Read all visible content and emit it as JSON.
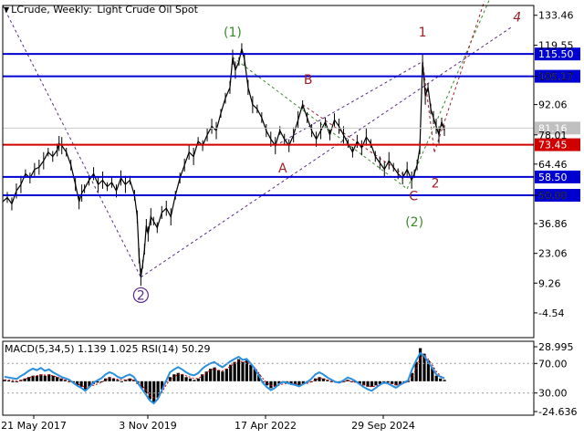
{
  "header": {
    "symbol": "LCrude, Weekly:",
    "description": "Light Crude Oil Spot",
    "icon": "down-triangle-icon"
  },
  "indicator_header": "MACD(5,34,5) 1.139 1.025 RSI(14) 50.29",
  "colors": {
    "price": "#000000",
    "level_blue": "#0000d0",
    "level_red": "#d00000",
    "current_price_tag": "#c0c0c0",
    "wave_green": "#3a8a2a",
    "wave_red": "#a0202a",
    "wave_purple": "#5a2a8a",
    "rsi": "#2b8fe0",
    "macd_signal": "#d00000"
  },
  "chart_data": [
    {
      "type": "line",
      "title": "LCrude, Weekly: Light Crude Oil Spot",
      "ylim": [
        -16,
        138
      ],
      "price_axis_ticks": [
        133.46,
        119.55,
        105.17,
        92.06,
        78.01,
        64.46,
        50.0,
        36.86,
        23.06,
        9.26,
        -4.54
      ],
      "x_tick_labels": [
        "21 May 2017",
        "3 Nov 2019",
        "17 Apr 2022",
        "29 Sep 2024"
      ],
      "current_price": 81.16,
      "levels": [
        {
          "value": 115.5,
          "label": "115.50",
          "color": "blue"
        },
        {
          "value": 105.17,
          "label": "105.17",
          "color": "blue"
        },
        {
          "value": 73.45,
          "label": "73.45",
          "color": "red"
        },
        {
          "value": 58.5,
          "label": "58.50",
          "color": "blue"
        },
        {
          "value": 50.0,
          "label": "50.00",
          "color": "blue"
        }
      ],
      "series": [
        {
          "values": [
            [
              0,
              47
            ],
            [
              5,
              49
            ],
            [
              10,
              46
            ],
            [
              15,
              52
            ],
            [
              20,
              55
            ],
            [
              25,
              60
            ],
            [
              30,
              58
            ],
            [
              35,
              62
            ],
            [
              40,
              63
            ],
            [
              45,
              66
            ],
            [
              50,
              70
            ],
            [
              55,
              68
            ],
            [
              60,
              71
            ],
            [
              62,
              74
            ],
            [
              65,
              73
            ],
            [
              70,
              70
            ],
            [
              75,
              64
            ],
            [
              80,
              55
            ],
            [
              84,
              47
            ],
            [
              87,
              51
            ],
            [
              90,
              53
            ],
            [
              95,
              57
            ],
            [
              100,
              60
            ],
            [
              105,
              55
            ],
            [
              110,
              57
            ],
            [
              115,
              54
            ],
            [
              120,
              56
            ],
            [
              125,
              52
            ],
            [
              130,
              58
            ],
            [
              135,
              55
            ],
            [
              140,
              57
            ],
            [
              145,
              50
            ],
            [
              148,
              40
            ],
            [
              150,
              22
            ],
            [
              152,
              12
            ],
            [
              154,
              18
            ],
            [
              156,
              25
            ],
            [
              158,
              36
            ],
            [
              160,
              32
            ],
            [
              163,
              40
            ],
            [
              166,
              38
            ],
            [
              170,
              35
            ],
            [
              175,
              42
            ],
            [
              180,
              44
            ],
            [
              185,
              40
            ],
            [
              190,
              50
            ],
            [
              195,
              58
            ],
            [
              200,
              64
            ],
            [
              205,
              70
            ],
            [
              210,
              68
            ],
            [
              215,
              75
            ],
            [
              220,
              73
            ],
            [
              225,
              78
            ],
            [
              230,
              82
            ],
            [
              235,
              80
            ],
            [
              240,
              88
            ],
            [
              245,
              95
            ],
            [
              250,
              100
            ],
            [
              253,
              114
            ],
            [
              256,
              108
            ],
            [
              260,
              112
            ],
            [
              263,
              118
            ],
            [
              266,
              113
            ],
            [
              270,
              100
            ],
            [
              275,
              92
            ],
            [
              280,
              90
            ],
            [
              285,
              86
            ],
            [
              290,
              80
            ],
            [
              295,
              76
            ],
            [
              300,
              73
            ],
            [
              305,
              80
            ],
            [
              310,
              76
            ],
            [
              315,
              73
            ],
            [
              320,
              78
            ],
            [
              325,
              85
            ],
            [
              330,
              92
            ],
            [
              335,
              86
            ],
            [
              340,
              80
            ],
            [
              345,
              76
            ],
            [
              350,
              80
            ],
            [
              355,
              84
            ],
            [
              360,
              78
            ],
            [
              365,
              85
            ],
            [
              370,
              82
            ],
            [
              375,
              78
            ],
            [
              380,
              74
            ],
            [
              385,
              70
            ],
            [
              390,
              75
            ],
            [
              395,
              72
            ],
            [
              400,
              77
            ],
            [
              405,
              74
            ],
            [
              410,
              68
            ],
            [
              415,
              65
            ],
            [
              420,
              62
            ],
            [
              425,
              66
            ],
            [
              430,
              63
            ],
            [
              435,
              60
            ],
            [
              440,
              58
            ],
            [
              445,
              62
            ],
            [
              450,
              57
            ],
            [
              453,
              60
            ],
            [
              456,
              64
            ],
            [
              459,
              72
            ],
            [
              462,
              112
            ],
            [
              465,
              96
            ],
            [
              468,
              100
            ],
            [
              471,
              90
            ],
            [
              474,
              86
            ],
            [
              477,
              82
            ],
            [
              480,
              78
            ],
            [
              483,
              84
            ],
            [
              486,
              80
            ]
          ]
        }
      ],
      "annotations": [
        {
          "text": "(1)",
          "color": "green"
        },
        {
          "text": "(2)",
          "color": "green"
        },
        {
          "text": "2",
          "color": "purple",
          "circled": true
        },
        {
          "text": "1",
          "color": "red"
        },
        {
          "text": "2",
          "color": "red"
        },
        {
          "text": "4",
          "color": "red"
        },
        {
          "text": "A",
          "color": "red"
        },
        {
          "text": "B",
          "color": "red"
        },
        {
          "text": "C",
          "color": "red"
        }
      ]
    },
    {
      "type": "bar",
      "title": "MACD(5,34,5) 1.139 1.025 RSI(14) 50.29",
      "ylim": [
        -24.636,
        28.995
      ],
      "indicator_axis_ticks": [
        28.995,
        70.0,
        30.0,
        -24.636
      ],
      "rsi_levels": [
        70,
        30
      ],
      "macd_histogram": [
        1,
        0.5,
        0,
        -0.5,
        1,
        2,
        3,
        4,
        4,
        5,
        4,
        5,
        4,
        3,
        2,
        1,
        0,
        -1,
        -3,
        -4,
        -6,
        -4,
        -2,
        -1,
        0,
        2,
        3,
        2,
        1,
        0,
        1,
        2,
        1,
        -2,
        -5,
        -9,
        -13,
        -15,
        -12,
        -6,
        0,
        3,
        5,
        6,
        5,
        3,
        2,
        1,
        2,
        5,
        7,
        9,
        10,
        8,
        7,
        9,
        12,
        14,
        16,
        14,
        15,
        12,
        9,
        5,
        -1,
        -3,
        -5,
        -4,
        -2,
        -1,
        -1,
        -2,
        -2,
        -3,
        -2,
        -1,
        0,
        2,
        3,
        2,
        1,
        0,
        -1,
        -1,
        0,
        1,
        0,
        -1,
        -2,
        -3,
        -4,
        -4,
        -3,
        -2,
        -1,
        -1,
        -2,
        -3,
        -2,
        -1,
        0,
        6,
        14,
        24,
        20,
        15,
        10,
        4,
        2,
        1
      ],
      "macd_signal": [
        1,
        1,
        0.5,
        0,
        0.5,
        1.5,
        2.5,
        3.5,
        4,
        4.5,
        4.5,
        4.5,
        4,
        3,
        2,
        1,
        0,
        -1,
        -2,
        -3,
        -4.5,
        -4,
        -3,
        -2,
        -1,
        1,
        2,
        2,
        1.5,
        1,
        1,
        1.5,
        1,
        -1,
        -3,
        -6,
        -10,
        -12,
        -12,
        -8,
        -3,
        1,
        3,
        5,
        5,
        4,
        3,
        2,
        2,
        4,
        6,
        8,
        9,
        8,
        7.5,
        9,
        11,
        13,
        15,
        14,
        14,
        12,
        10,
        6,
        2,
        -1,
        -3,
        -3.5,
        -3,
        -2,
        -1.5,
        -2,
        -2,
        -2.5,
        -2,
        -1.5,
        -0.5,
        1,
        2,
        2,
        1,
        0,
        -0.5,
        -1,
        -0.5,
        0.5,
        0,
        -0.5,
        -1.5,
        -2.5,
        -3.5,
        -4,
        -3.5,
        -2.5,
        -1.5,
        -1.2,
        -1.8,
        -2.5,
        -2,
        -1.2,
        -0.5,
        3,
        9,
        17,
        19,
        16,
        12,
        7,
        4,
        2
      ],
      "rsi": [
        52,
        51,
        50,
        49,
        53,
        56,
        60,
        63,
        61,
        64,
        60,
        62,
        58,
        55,
        52,
        50,
        48,
        44,
        40,
        37,
        33,
        38,
        44,
        47,
        50,
        55,
        58,
        56,
        52,
        50,
        53,
        55,
        52,
        44,
        36,
        28,
        20,
        16,
        22,
        34,
        46,
        58,
        62,
        65,
        62,
        58,
        55,
        54,
        57,
        63,
        67,
        70,
        72,
        68,
        65,
        69,
        73,
        76,
        79,
        75,
        76,
        70,
        63,
        54,
        44,
        38,
        34,
        37,
        42,
        45,
        44,
        42,
        41,
        39,
        42,
        45,
        49,
        55,
        58,
        55,
        51,
        48,
        45,
        44,
        47,
        51,
        49,
        46,
        42,
        38,
        35,
        33,
        37,
        41,
        44,
        43,
        40,
        37,
        41,
        44,
        47,
        62,
        74,
        84,
        80,
        72,
        64,
        55,
        52,
        50
      ]
    }
  ]
}
